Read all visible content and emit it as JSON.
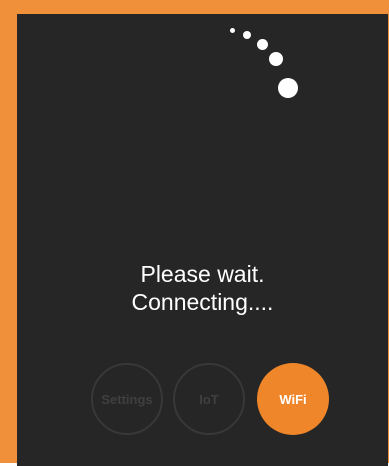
{
  "status": {
    "line1": "Please wait.",
    "line2": "Connecting...."
  },
  "nav": {
    "settings_label": "Settings",
    "iot_label": "IoT",
    "wifi_label": "WiFi",
    "active_tab": "WiFi"
  },
  "spinner": {
    "icon": "loading-spinner-icon"
  },
  "colors": {
    "frame": "#f0903a",
    "screen_background": "#262626",
    "accent": "#f0862a",
    "text": "#ffffff",
    "inactive_ring": "#383838"
  }
}
